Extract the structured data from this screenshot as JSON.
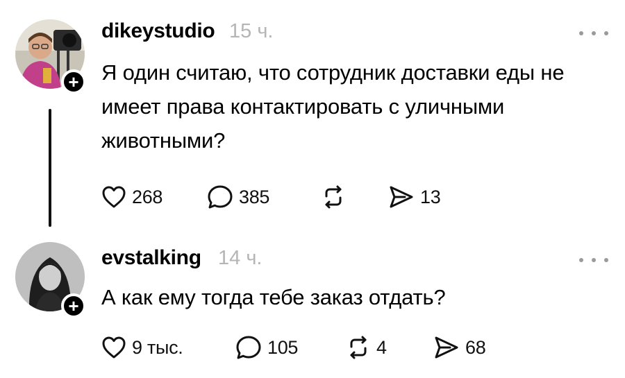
{
  "posts": [
    {
      "username": "dikeystudio",
      "time": "15 ч.",
      "text": "Я один считаю, что сотрудник доставки еды не имеет права контактировать с уличными животными?",
      "likes": "268",
      "comments": "385",
      "reposts": "",
      "shares": "13",
      "follow_label": "+"
    },
    {
      "username": "evstalking",
      "time": "14 ч.",
      "text": "А как ему тогда тебе заказ отдать?",
      "likes": "9 тыс.",
      "comments": "105",
      "reposts": "4",
      "shares": "68",
      "follow_label": "+"
    }
  ],
  "icons": {
    "like": "heart-icon",
    "comment": "speech-bubble-icon",
    "repost": "repost-arrows-icon",
    "share": "send-icon",
    "more": "ellipsis-icon"
  },
  "colors": {
    "text": "#000000",
    "muted": "#b5b5b5",
    "dots": "#9a9a9a",
    "background": "#ffffff"
  }
}
